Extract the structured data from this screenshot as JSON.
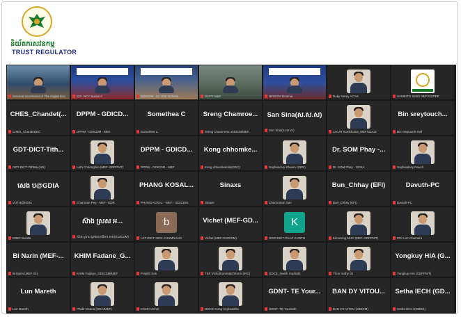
{
  "header": {
    "logo_icon": "trust-regulator-eagle-icon",
    "logo_text_km": "និយ័តករសវនកម្ម",
    "logo_text_en": "TRUST REGULATOR"
  },
  "colors": {
    "grid_bg": "#1f1f1f",
    "tile_bg": "#262626",
    "mic_muted": "#e23b3b",
    "logo_gold": "#d8a628",
    "logo_green": "#1a7a2c",
    "logo_navy": "#1f2f80"
  },
  "participants": [
    {
      "name": "",
      "caption": "General Secretariat of The Digital Eco",
      "kind": "room1"
    },
    {
      "name": "",
      "caption": "CIT- NCY Savan A",
      "kind": "room2"
    },
    {
      "name": "",
      "caption": "GDICDM - Dr. SIM Vicheka",
      "kind": "room3"
    },
    {
      "name": "",
      "caption": "GDPP-MEF",
      "kind": "room4"
    },
    {
      "name": "",
      "caption": "NFISON Sisamai",
      "kind": "room5"
    },
    {
      "name": "",
      "caption": "Doky Neary ACAR",
      "kind": "person"
    },
    {
      "name": "",
      "caption": "SAMEITO Setsh MEF/GDPPP",
      "kind": "logo"
    },
    {
      "name": "CHES_Chandet(...",
      "caption": "CHES_Chandet(EC",
      "kind": "text"
    },
    {
      "name": "DPPM - GDICD...",
      "caption": "DPPM - GDICDM - MEF",
      "kind": "text"
    },
    {
      "name": "Somethea C",
      "caption": "Somethea C",
      "kind": "text"
    },
    {
      "name": "Sreng Chamroe...",
      "caption": "Sreng Chamroeun GDICM/MEF",
      "kind": "text"
    },
    {
      "name": "San Sina(ស.ស.ស)",
      "caption": "San Sina(ស.ស.ស)",
      "kind": "text"
    },
    {
      "name": "",
      "caption": "CHUH Somkholna_MEF/GDCE",
      "kind": "person"
    },
    {
      "name": "Bin sreytouch...",
      "caption": "Bin sreytouch-mef",
      "kind": "text"
    },
    {
      "name": "GDT-DICT-Tith...",
      "caption": "GDT-DICT-TithMa (HR)",
      "kind": "text"
    },
    {
      "name": "",
      "caption": "Loth Chhengkim (MEF-GDPPMT)",
      "kind": "person"
    },
    {
      "name": "DPPM - GDICD...",
      "caption": "DPPM - GDICDM - MEF",
      "kind": "text"
    },
    {
      "name": "Kong chhomke...",
      "caption": "Kong chhomkemlis(GDC)",
      "kind": "text"
    },
    {
      "name": "",
      "caption": "Sophearory Khuem (GDE)",
      "kind": "person"
    },
    {
      "name": "Dr. SOM Phay -...",
      "caption": "Dr. SOM Phay - GDSA",
      "kind": "text"
    },
    {
      "name": "",
      "caption": "Sopheakrey Nouch",
      "kind": "person"
    },
    {
      "name": "សេង ប@GDIA",
      "caption": "VUTH@GDIA",
      "kind": "text"
    },
    {
      "name": "",
      "caption": "Chamnan Pey - MEF- GDR",
      "kind": "person"
    },
    {
      "name": "PHANG KOSAL...",
      "caption": "PHANG KOSAL - MEF - GDICDM",
      "kind": "text"
    },
    {
      "name": "Sinaxs",
      "caption": "Sinaxs",
      "kind": "text"
    },
    {
      "name": "",
      "caption": "Chamroeun Sao",
      "kind": "person"
    },
    {
      "name": "Bun_Chhay (EFI)",
      "caption": "Bun_Chhay (EFI)",
      "kind": "text"
    },
    {
      "name": "Davuth-PC",
      "caption": "Davuth-PC",
      "kind": "text"
    },
    {
      "name": "",
      "caption": "MING Bunda",
      "kind": "person"
    },
    {
      "name": "ស៊ាង ស្រស អ...",
      "caption": "ស៊ាង ស្រស អ្នកលេខាធិការ ភាព(GDICDM)",
      "kind": "text"
    },
    {
      "name": "",
      "caption": "LKT-DICT-3201-CHUMNANG",
      "kind": "avatar",
      "letter": "b",
      "color": "#8a6a55"
    },
    {
      "name": "Vichet (MEF-GD...",
      "caption": "Vichet (MEF-GDICDM)",
      "kind": "text"
    },
    {
      "name": "",
      "caption": "GDR-DICT-PHAP KUNTH",
      "kind": "avatar",
      "letter": "K",
      "color": "#12a38c"
    },
    {
      "name": "",
      "caption": "Kimsreng MUC (MEF-GDPPMT)",
      "kind": "person"
    },
    {
      "name": "",
      "caption": "IRC-Loc Chamara",
      "kind": "person"
    },
    {
      "name": "Bi Narin (MEF-...",
      "caption": "Bi Narin (MEF-GI)",
      "kind": "text"
    },
    {
      "name": "KHIM Fadane_G...",
      "caption": "KHIM Fadane_GDICDM/MEF",
      "kind": "text"
    },
    {
      "name": "",
      "caption": "Prasith Sok",
      "kind": "person"
    },
    {
      "name": "",
      "caption": "TEF Vichothonmakchhorm (IRC)",
      "kind": "person"
    },
    {
      "name": "",
      "caption": "GDCE_Hueth Sophath",
      "kind": "person"
    },
    {
      "name": "",
      "caption": "Thon Vuthy GI",
      "kind": "person"
    },
    {
      "name": "Yongkuy HIA (G...",
      "caption": "Yongkuy HIA (GDPPMT)",
      "kind": "text"
    },
    {
      "name": "Lun Mareth",
      "caption": "Lun Mareth",
      "kind": "text"
    },
    {
      "name": "",
      "caption": "Pholit Visana (GDA/MEF)",
      "kind": "person"
    },
    {
      "name": "",
      "caption": "Khieth Vichet",
      "kind": "person"
    },
    {
      "name": "",
      "caption": "GDCE-Kong Seyheakha",
      "kind": "person"
    },
    {
      "name": "GDNT- TE Your...",
      "caption": "GDNT- TE Yourseth",
      "kind": "text"
    },
    {
      "name": "BAN DY VITOU...",
      "caption": "BAN DY VITOU (GDIDM)",
      "kind": "text"
    },
    {
      "name": "Setha IECH (GD...",
      "caption": "Setha IECH (GDDE)",
      "kind": "text"
    }
  ]
}
